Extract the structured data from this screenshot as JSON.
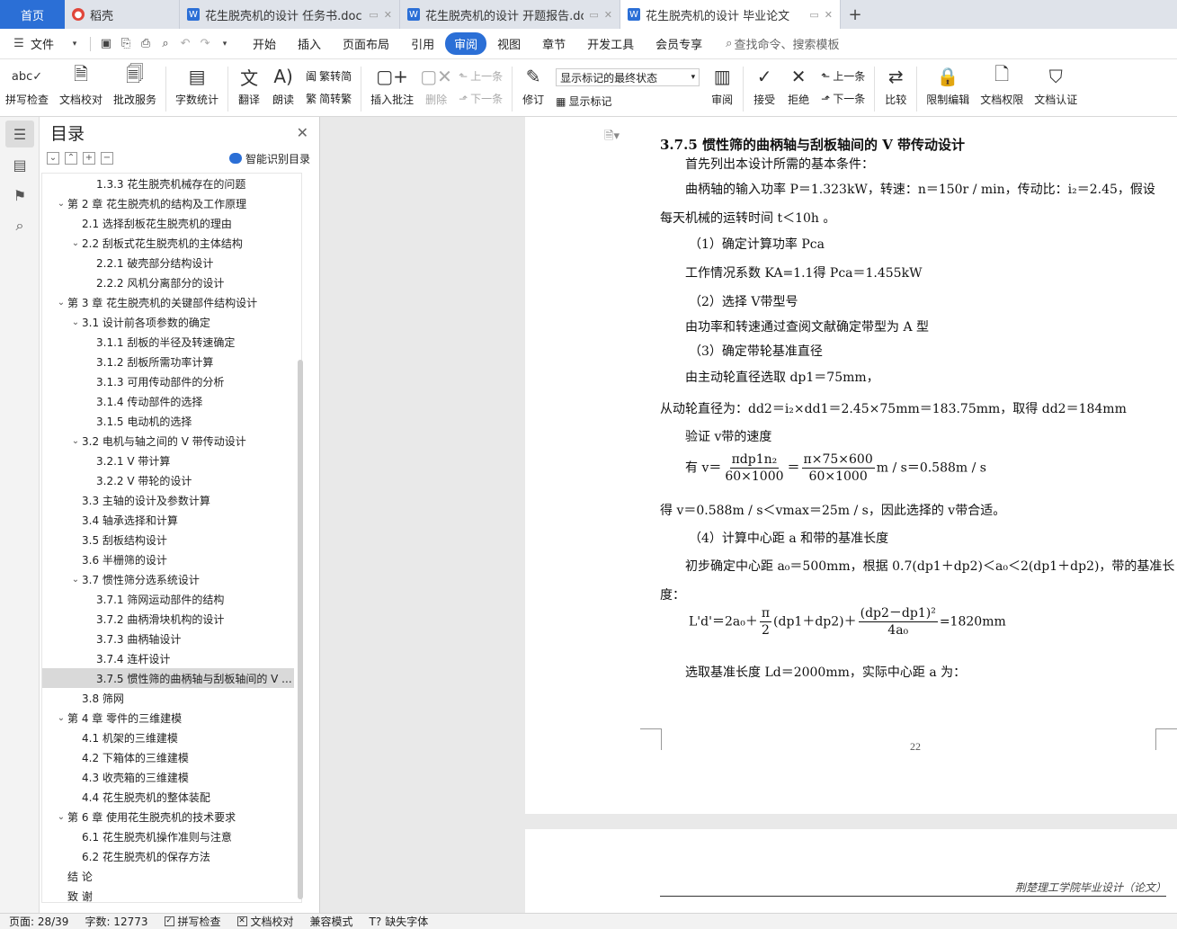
{
  "tabs": {
    "home": "首页",
    "items": [
      {
        "label": "稻壳",
        "icon": "docer-icon"
      },
      {
        "label": "花生脱壳机的设计 任务书.doc",
        "icon": "word-icon"
      },
      {
        "label": "花生脱壳机的设计 开题报告.doc",
        "icon": "word-icon"
      },
      {
        "label": "花生脱壳机的设计 毕业论文",
        "icon": "word-icon"
      }
    ],
    "add": "+"
  },
  "menu": {
    "file": "文件",
    "items": [
      "开始",
      "插入",
      "页面布局",
      "引用",
      "审阅",
      "视图",
      "章节",
      "开发工具",
      "会员专享"
    ],
    "active": "审阅",
    "search": "查找命令、搜索模板"
  },
  "ribbon": {
    "spell": "拼写检查",
    "proof": "文档校对",
    "annot_service": "批改服务",
    "wordcount": "字数统计",
    "translate": "翻译",
    "read": "朗读",
    "to_trad": "繁转简",
    "to_simp": "简转繁",
    "insert_comment": "插入批注",
    "delete": "删除",
    "prev": "上一条",
    "next": "下一条",
    "revise": "修订",
    "markup_state": "显示标记的最终状态",
    "show_markup": "显示标记",
    "review": "审阅",
    "accept": "接受",
    "reject": "拒绝",
    "prev2": "上一条",
    "next2": "下一条",
    "compare": "比较",
    "restrict": "限制编辑",
    "rights": "文档权限",
    "certify": "文档认证"
  },
  "toc": {
    "title": "目录",
    "smart": "智能识别目录",
    "items": [
      {
        "level": 3,
        "text": "1.3.3  花生脱壳机械存在的问题",
        "arrow": ""
      },
      {
        "level": 1,
        "text": "第 2 章  花生脱壳机的结构及工作原理",
        "arrow": "v"
      },
      {
        "level": 2,
        "text": "2.1  选择刮板花生脱壳机的理由",
        "arrow": ""
      },
      {
        "level": 2,
        "text": "2.2  刮板式花生脱壳机的主体结构",
        "arrow": "v"
      },
      {
        "level": 3,
        "text": "2.2.1  破壳部分结构设计",
        "arrow": ""
      },
      {
        "level": 3,
        "text": "2.2.2  风机分离部分的设计",
        "arrow": ""
      },
      {
        "level": 1,
        "text": "第 3 章  花生脱壳机的关键部件结构设计",
        "arrow": "v"
      },
      {
        "level": 2,
        "text": "3.1  设计前各项参数的确定",
        "arrow": "v"
      },
      {
        "level": 3,
        "text": "3.1.1  刮板的半径及转速确定",
        "arrow": ""
      },
      {
        "level": 3,
        "text": "3.1.2  刮板所需功率计算",
        "arrow": ""
      },
      {
        "level": 3,
        "text": "3.1.3  可用传动部件的分析",
        "arrow": ""
      },
      {
        "level": 3,
        "text": "3.1.4  传动部件的选择",
        "arrow": ""
      },
      {
        "level": 3,
        "text": "3.1.5  电动机的选择",
        "arrow": ""
      },
      {
        "level": 2,
        "text": "3.2  电机与轴之间的 V 带传动设计",
        "arrow": "v"
      },
      {
        "level": 3,
        "text": "3.2.1 V 带计算",
        "arrow": ""
      },
      {
        "level": 3,
        "text": "3.2.2 V 带轮的设计",
        "arrow": ""
      },
      {
        "level": 2,
        "text": "3.3  主轴的设计及参数计算",
        "arrow": ""
      },
      {
        "level": 2,
        "text": "3.4  轴承选择和计算",
        "arrow": ""
      },
      {
        "level": 2,
        "text": "3.5  刮板结构设计",
        "arrow": ""
      },
      {
        "level": 2,
        "text": "3.6  半栅筛的设计",
        "arrow": ""
      },
      {
        "level": 2,
        "text": "3.7  惯性筛分选系统设计",
        "arrow": "v"
      },
      {
        "level": 3,
        "text": "3.7.1  筛网运动部件的结构",
        "arrow": ""
      },
      {
        "level": 3,
        "text": "3.7.2  曲柄滑块机构的设计",
        "arrow": ""
      },
      {
        "level": 3,
        "text": "3.7.3  曲柄轴设计",
        "arrow": ""
      },
      {
        "level": 3,
        "text": "3.7.4  连杆设计",
        "arrow": ""
      },
      {
        "level": 3,
        "text": "3.7.5  惯性筛的曲柄轴与刮板轴间的 V ...",
        "arrow": "",
        "selected": true
      },
      {
        "level": 2,
        "text": "3.8  筛网",
        "arrow": ""
      },
      {
        "level": 1,
        "text": "第 4 章  零件的三维建模",
        "arrow": "v"
      },
      {
        "level": 2,
        "text": "4.1  机架的三维建模",
        "arrow": ""
      },
      {
        "level": 2,
        "text": "4.2  下箱体的三维建模",
        "arrow": ""
      },
      {
        "level": 2,
        "text": "4.3  收壳箱的三维建模",
        "arrow": ""
      },
      {
        "level": 2,
        "text": "4.4  花生脱壳机的整体装配",
        "arrow": ""
      },
      {
        "level": 1,
        "text": "第 6 章  使用花生脱壳机的技术要求",
        "arrow": "v"
      },
      {
        "level": 2,
        "text": "6.1  花生脱壳机操作准则与注意",
        "arrow": ""
      },
      {
        "level": 2,
        "text": "6.2  花生脱壳机的保存方法",
        "arrow": ""
      },
      {
        "level": 1,
        "text": "结    论",
        "arrow": ""
      },
      {
        "level": 1,
        "text": "致    谢",
        "arrow": ""
      }
    ]
  },
  "doc": {
    "heading": "3.7.5  惯性筛的曲柄轴与刮板轴间的 V 带传动设计",
    "l1": "首先列出本设计所需的基本条件：",
    "l2": "曲柄轴的输入功率 P＝1.323kW，转速：n＝150r / min，传动比：i₂＝2.45，假设",
    "l3": "每天机械的运转时间 t＜10h 。",
    "l4": "（1）确定计算功率 Pca",
    "l5": "工作情况系数 KA=1.1得    Pca＝1.455kW",
    "l6": "（2）选择 V带型号",
    "l7": "由功率和转速通过查阅文献确定带型为 A 型",
    "l8": "（3）确定带轮基准直径",
    "l9": "由主动轮直径选取 dp1＝75mm，",
    "l10": "从动轮直径为：dd2＝i₂×dd1＝2.45×75mm＝183.75mm，取得 dd2＝184mm",
    "l11": "验证 v带的速度",
    "l12_pre": "有 v＝",
    "l12_f1n": "πdp1n₂",
    "l12_f1d": "60×1000",
    "l12_eq": "＝",
    "l12_f2n": "π×75×600",
    "l12_f2d": "60×1000",
    "l12_post": "m / s＝0.588m / s",
    "l13": "得 v＝0.588m / s＜vmax＝25m / s，因此选择的 v带合适。",
    "l14": "（4）计算中心距 a 和带的基准长度",
    "l15": "初步确定中心距 a₀＝500mm，根据 0.7(dp1＋dp2)＜a₀＜2(dp1＋dp2)，带的基准长",
    "l16": "度：",
    "l17_pre": "L'd'＝2a₀＋",
    "l17_f1n": "π",
    "l17_f1d": "2",
    "l17_mid": "(dp1＋dp2)＋",
    "l17_f2n": "(dp2－dp1)²",
    "l17_f2d": "4a₀",
    "l17_post": "=1820mm",
    "l18": "选取基准长度 Ld＝2000mm，实际中心距 a 为：",
    "page_number": "22",
    "next_page_header": "荆楚理工学院毕业设计（论文）"
  },
  "status": {
    "page": "页面: 28/39",
    "words": "字数: 12773",
    "spell": "拼写检查",
    "proof": "文档校对",
    "compat": "兼容模式",
    "missing_font": "缺失字体"
  }
}
